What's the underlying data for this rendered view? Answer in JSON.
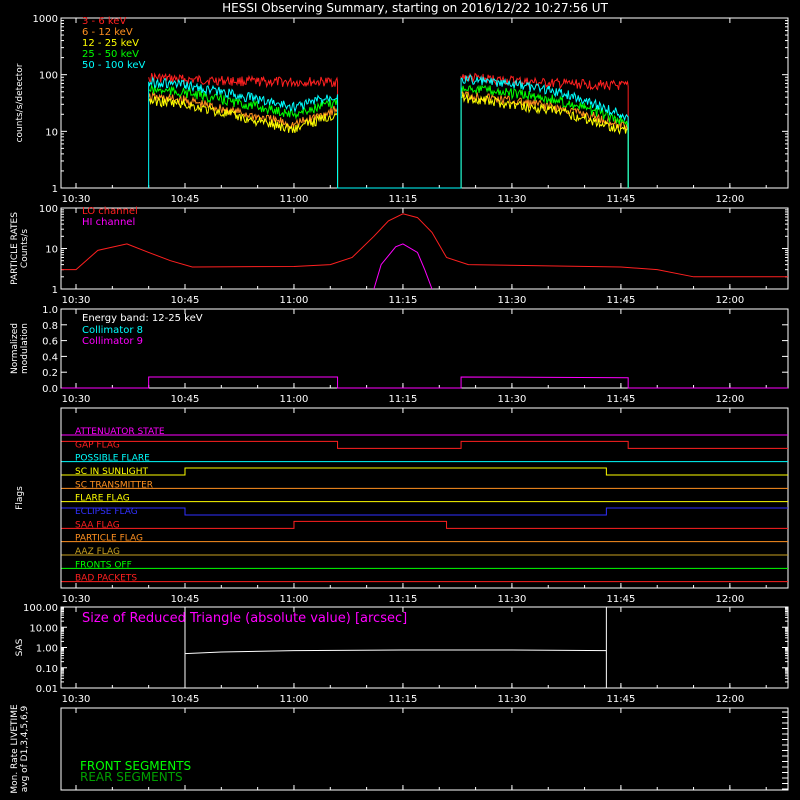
{
  "title": "HESSI Observing Summary, starting on 2016/12/22 10:27:56 UT",
  "time_axis": {
    "start": "10:27:56",
    "end": "12:08",
    "ticks": [
      "10:30",
      "10:45",
      "11:00",
      "11:15",
      "11:30",
      "11:45",
      "12:00"
    ]
  },
  "chart_data": [
    {
      "id": "count-rates",
      "type": "line",
      "ylabel": "counts/s/detector",
      "yscale": "log",
      "ylim": [
        1,
        1000
      ],
      "y_ticks": [
        "1",
        "10",
        "100",
        "1000"
      ],
      "legend_placement": "top-left",
      "series": [
        {
          "name": "3 - 6 keV",
          "color": "#ff2020",
          "points": [
            [
              "10:40",
              90
            ],
            [
              "10:45",
              82
            ],
            [
              "10:55",
              75
            ],
            [
              "11:00",
              74
            ],
            [
              "11:06",
              75
            ],
            [
              "11:06",
              1
            ],
            [
              "11:23",
              1
            ],
            [
              "11:23",
              90
            ],
            [
              "11:35",
              70
            ],
            [
              "11:40",
              68
            ],
            [
              "11:46",
              62
            ],
            [
              "11:46",
              1
            ]
          ]
        },
        {
          "name": "6 - 12 keV",
          "color": "#ff9020",
          "points": [
            [
              "10:40",
              40
            ],
            [
              "10:45",
              35
            ],
            [
              "10:55",
              18
            ],
            [
              "11:00",
              13
            ],
            [
              "11:06",
              25
            ],
            [
              "11:06",
              1
            ],
            [
              "11:23",
              1
            ],
            [
              "11:23",
              45
            ],
            [
              "11:35",
              28
            ],
            [
              "11:40",
              20
            ],
            [
              "11:46",
              12
            ],
            [
              "11:46",
              1
            ]
          ]
        },
        {
          "name": "12 - 25 keV",
          "color": "#ffff00",
          "points": [
            [
              "10:40",
              35
            ],
            [
              "10:45",
              30
            ],
            [
              "10:55",
              15
            ],
            [
              "11:00",
              11
            ],
            [
              "11:06",
              21
            ],
            [
              "11:06",
              1
            ],
            [
              "11:23",
              1
            ],
            [
              "11:23",
              40
            ],
            [
              "11:35",
              24
            ],
            [
              "11:40",
              17
            ],
            [
              "11:46",
              10
            ],
            [
              "11:46",
              1
            ]
          ]
        },
        {
          "name": "25 - 50 keV",
          "color": "#00ff00",
          "points": [
            [
              "10:40",
              55
            ],
            [
              "10:45",
              48
            ],
            [
              "10:55",
              27
            ],
            [
              "11:00",
              20
            ],
            [
              "11:06",
              33
            ],
            [
              "11:06",
              1
            ],
            [
              "11:23",
              1
            ],
            [
              "11:23",
              62
            ],
            [
              "11:35",
              38
            ],
            [
              "11:40",
              26
            ],
            [
              "11:46",
              14
            ],
            [
              "11:46",
              1
            ]
          ]
        },
        {
          "name": "50 - 100 keV",
          "color": "#00ffff",
          "points": [
            [
              "10:40",
              1
            ],
            [
              "10:40",
              75
            ],
            [
              "10:45",
              65
            ],
            [
              "10:55",
              37
            ],
            [
              "11:00",
              27
            ],
            [
              "11:06",
              45
            ],
            [
              "11:06",
              1
            ],
            [
              "11:23",
              1
            ],
            [
              "11:23",
              85
            ],
            [
              "11:35",
              55
            ],
            [
              "11:40",
              36
            ],
            [
              "11:46",
              18
            ],
            [
              "11:46",
              1
            ]
          ]
        }
      ]
    },
    {
      "id": "particle-rates",
      "type": "line",
      "ylabel_lines": [
        "PARTICLE RATES",
        "Counts/s"
      ],
      "yscale": "log",
      "ylim": [
        1,
        100
      ],
      "y_ticks": [
        "1",
        "10",
        "100"
      ],
      "legend_placement": "top-left",
      "series": [
        {
          "name": "LO channel",
          "color": "#ff2020",
          "points": [
            [
              "10:28",
              3
            ],
            [
              "10:30",
              3
            ],
            [
              "10:33",
              9
            ],
            [
              "10:37",
              13
            ],
            [
              "10:40",
              8
            ],
            [
              "10:43",
              5
            ],
            [
              "10:46",
              3.5
            ],
            [
              "11:00",
              3.6
            ],
            [
              "11:05",
              4
            ],
            [
              "11:08",
              6
            ],
            [
              "11:11",
              20
            ],
            [
              "11:13",
              48
            ],
            [
              "11:15",
              72
            ],
            [
              "11:17",
              58
            ],
            [
              "11:19",
              25
            ],
            [
              "11:21",
              6
            ],
            [
              "11:24",
              4
            ],
            [
              "11:45",
              3.5
            ],
            [
              "11:50",
              3
            ],
            [
              "11:55",
              2
            ],
            [
              "12:00",
              2
            ],
            [
              "12:08",
              2
            ]
          ]
        },
        {
          "name": "HI channel",
          "color": "#ff00ff",
          "points": [
            [
              "11:11",
              1
            ],
            [
              "11:12",
              4
            ],
            [
              "11:14",
              11
            ],
            [
              "11:15",
              13
            ],
            [
              "11:17",
              8
            ],
            [
              "11:18",
              3
            ],
            [
              "11:19",
              1
            ]
          ]
        }
      ]
    },
    {
      "id": "modulation",
      "type": "line",
      "ylabel_lines": [
        "Normalized",
        "modulation"
      ],
      "ylim": [
        0.0,
        1.0
      ],
      "y_ticks": [
        "0.0",
        "0.2",
        "0.4",
        "0.6",
        "0.8",
        "1.0"
      ],
      "annotation": "Energy band: 12-25 keV",
      "series": [
        {
          "name": "Collimator 8",
          "color": "#00ffff",
          "points": []
        },
        {
          "name": "Collimator 9",
          "color": "#ff00ff",
          "points": [
            [
              "10:28",
              0.0
            ],
            [
              "10:40",
              0.0
            ],
            [
              "10:40",
              0.14
            ],
            [
              "11:06",
              0.14
            ],
            [
              "11:06",
              0.0
            ],
            [
              "11:23",
              0.0
            ],
            [
              "11:23",
              0.14
            ],
            [
              "11:46",
              0.13
            ],
            [
              "11:46",
              0.0
            ],
            [
              "12:08",
              0.0
            ]
          ]
        }
      ]
    },
    {
      "id": "flags",
      "type": "line",
      "ylabel": "Flags",
      "series": [
        {
          "name": "ATTENUATOR STATE",
          "color": "#ff00ff",
          "segments": [
            [
              "10:28",
              "12:08",
              0
            ]
          ]
        },
        {
          "name": "GAP FLAG",
          "color": "#ff2020",
          "segments": [
            [
              "10:28",
              "11:06",
              1
            ],
            [
              "11:06",
              "11:23",
              0
            ],
            [
              "11:23",
              "11:46",
              1
            ],
            [
              "11:46",
              "12:08",
              0
            ]
          ]
        },
        {
          "name": "POSSIBLE FLARE",
          "color": "#00ffff",
          "segments": [
            [
              "10:28",
              "12:08",
              0
            ]
          ]
        },
        {
          "name": "SC IN SUNLIGHT",
          "color": "#ffff00",
          "segments": [
            [
              "10:28",
              "10:45",
              0
            ],
            [
              "10:45",
              "11:43",
              1
            ],
            [
              "11:43",
              "12:08",
              0
            ]
          ]
        },
        {
          "name": "SC TRANSMITTER",
          "color": "#ff9020",
          "segments": [
            [
              "10:28",
              "12:08",
              0
            ]
          ]
        },
        {
          "name": "FLARE FLAG",
          "color": "#ffff00",
          "segments": [
            [
              "10:28",
              "12:08",
              0
            ]
          ]
        },
        {
          "name": "ECLIPSE FLAG",
          "color": "#3030ff",
          "segments": [
            [
              "10:28",
              "10:45",
              1
            ],
            [
              "10:45",
              "11:43",
              0
            ],
            [
              "11:43",
              "12:08",
              1
            ]
          ]
        },
        {
          "name": "SAA FLAG",
          "color": "#ff2020",
          "segments": [
            [
              "10:28",
              "11:00",
              0
            ],
            [
              "11:00",
              "11:21",
              1
            ],
            [
              "11:21",
              "12:08",
              0
            ]
          ]
        },
        {
          "name": "PARTICLE FLAG",
          "color": "#ff9020",
          "segments": [
            [
              "10:28",
              "12:08",
              0
            ]
          ]
        },
        {
          "name": "AAZ FLAG",
          "color": "#c8a020",
          "segments": [
            [
              "10:28",
              "12:08",
              0
            ]
          ]
        },
        {
          "name": "FRONTS OFF",
          "color": "#00ff00",
          "segments": [
            [
              "10:28",
              "12:08",
              0
            ]
          ]
        },
        {
          "name": "BAD PACKETS",
          "color": "#ff2020",
          "segments": [
            [
              "10:28",
              "12:08",
              0
            ]
          ]
        }
      ]
    },
    {
      "id": "sas",
      "type": "line",
      "ylabel": "SAS",
      "yscale": "log",
      "ylim": [
        0.01,
        100.0
      ],
      "y_ticks": [
        "0.01",
        "0.10",
        "1.00",
        "10.00",
        "100.00"
      ],
      "annotation": "Size of Reduced Triangle (absolute value) [arcsec]",
      "series": [
        {
          "name": "SAS",
          "color": "#ffffff",
          "points": [
            [
              "10:45",
              0.01
            ],
            [
              "10:45",
              100
            ],
            [
              "10:45",
              0.5
            ],
            [
              "10:50",
              0.6
            ],
            [
              "11:00",
              0.7
            ],
            [
              "11:15",
              0.75
            ],
            [
              "11:30",
              0.75
            ],
            [
              "11:43",
              0.7
            ],
            [
              "11:43",
              100
            ],
            [
              "11:43",
              0.01
            ]
          ]
        }
      ]
    },
    {
      "id": "livetime",
      "type": "line",
      "ylabel_lines": [
        "Mon. Rate LIVETIME",
        "avg of D1,3,4,5,6,9"
      ],
      "legend_placement": "bottom-left",
      "series": [
        {
          "name": "FRONT SEGMENTS",
          "color": "#00ff00",
          "points": []
        },
        {
          "name": "REAR SEGMENTS",
          "color": "#00a000",
          "points": []
        }
      ]
    }
  ]
}
